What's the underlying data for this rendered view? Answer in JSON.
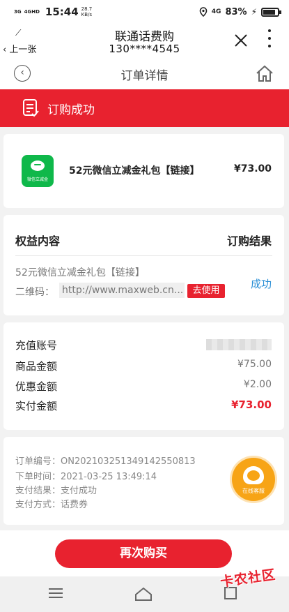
{
  "status_bar": {
    "net_left": "3G",
    "net_right": "4GHD",
    "time": "15:44",
    "speed_value": "28.7",
    "speed_unit": "KB/s",
    "signal": "4G",
    "battery": "83%"
  },
  "app_header": {
    "back_label": "上一张",
    "title": "联通话费购",
    "phone": "130****4545"
  },
  "nav": {
    "title": "订单详情"
  },
  "banner": {
    "label": "订购成功"
  },
  "product": {
    "logo_text": "微信立减金",
    "name": "52元微信立减金礼包【链接】",
    "price": "¥73.00"
  },
  "benefit": {
    "header_left": "权益内容",
    "header_right": "订购结果",
    "item_name": "52元微信立减金礼包【链接】",
    "qr_label": "二维码：",
    "qr_value": "http://www.maxweb.cn...",
    "use_button": "去使用",
    "result": "成功"
  },
  "amounts": {
    "rows": [
      {
        "label": "充值账号",
        "value": ""
      },
      {
        "label": "商品金额",
        "value": "¥75.00"
      },
      {
        "label": "优惠金额",
        "value": "¥2.00"
      },
      {
        "label": "实付金额",
        "value": "¥73.00"
      }
    ]
  },
  "order_info": {
    "order_no": "订单编号：ON20210325134914255081​3",
    "order_time": "下单时间：2021-03-25 13:49:14",
    "pay_result": "支付结果：支付成功",
    "pay_method": "支付方式：话费券"
  },
  "service": {
    "label": "在线客服"
  },
  "bottom": {
    "buy_again": "再次购买"
  },
  "watermark": "卡农社区",
  "colors": {
    "accent": "#e8222f",
    "success_blue": "#2a8fd6",
    "wechat_green": "#0fb84a",
    "service_orange": "#f7a416"
  }
}
